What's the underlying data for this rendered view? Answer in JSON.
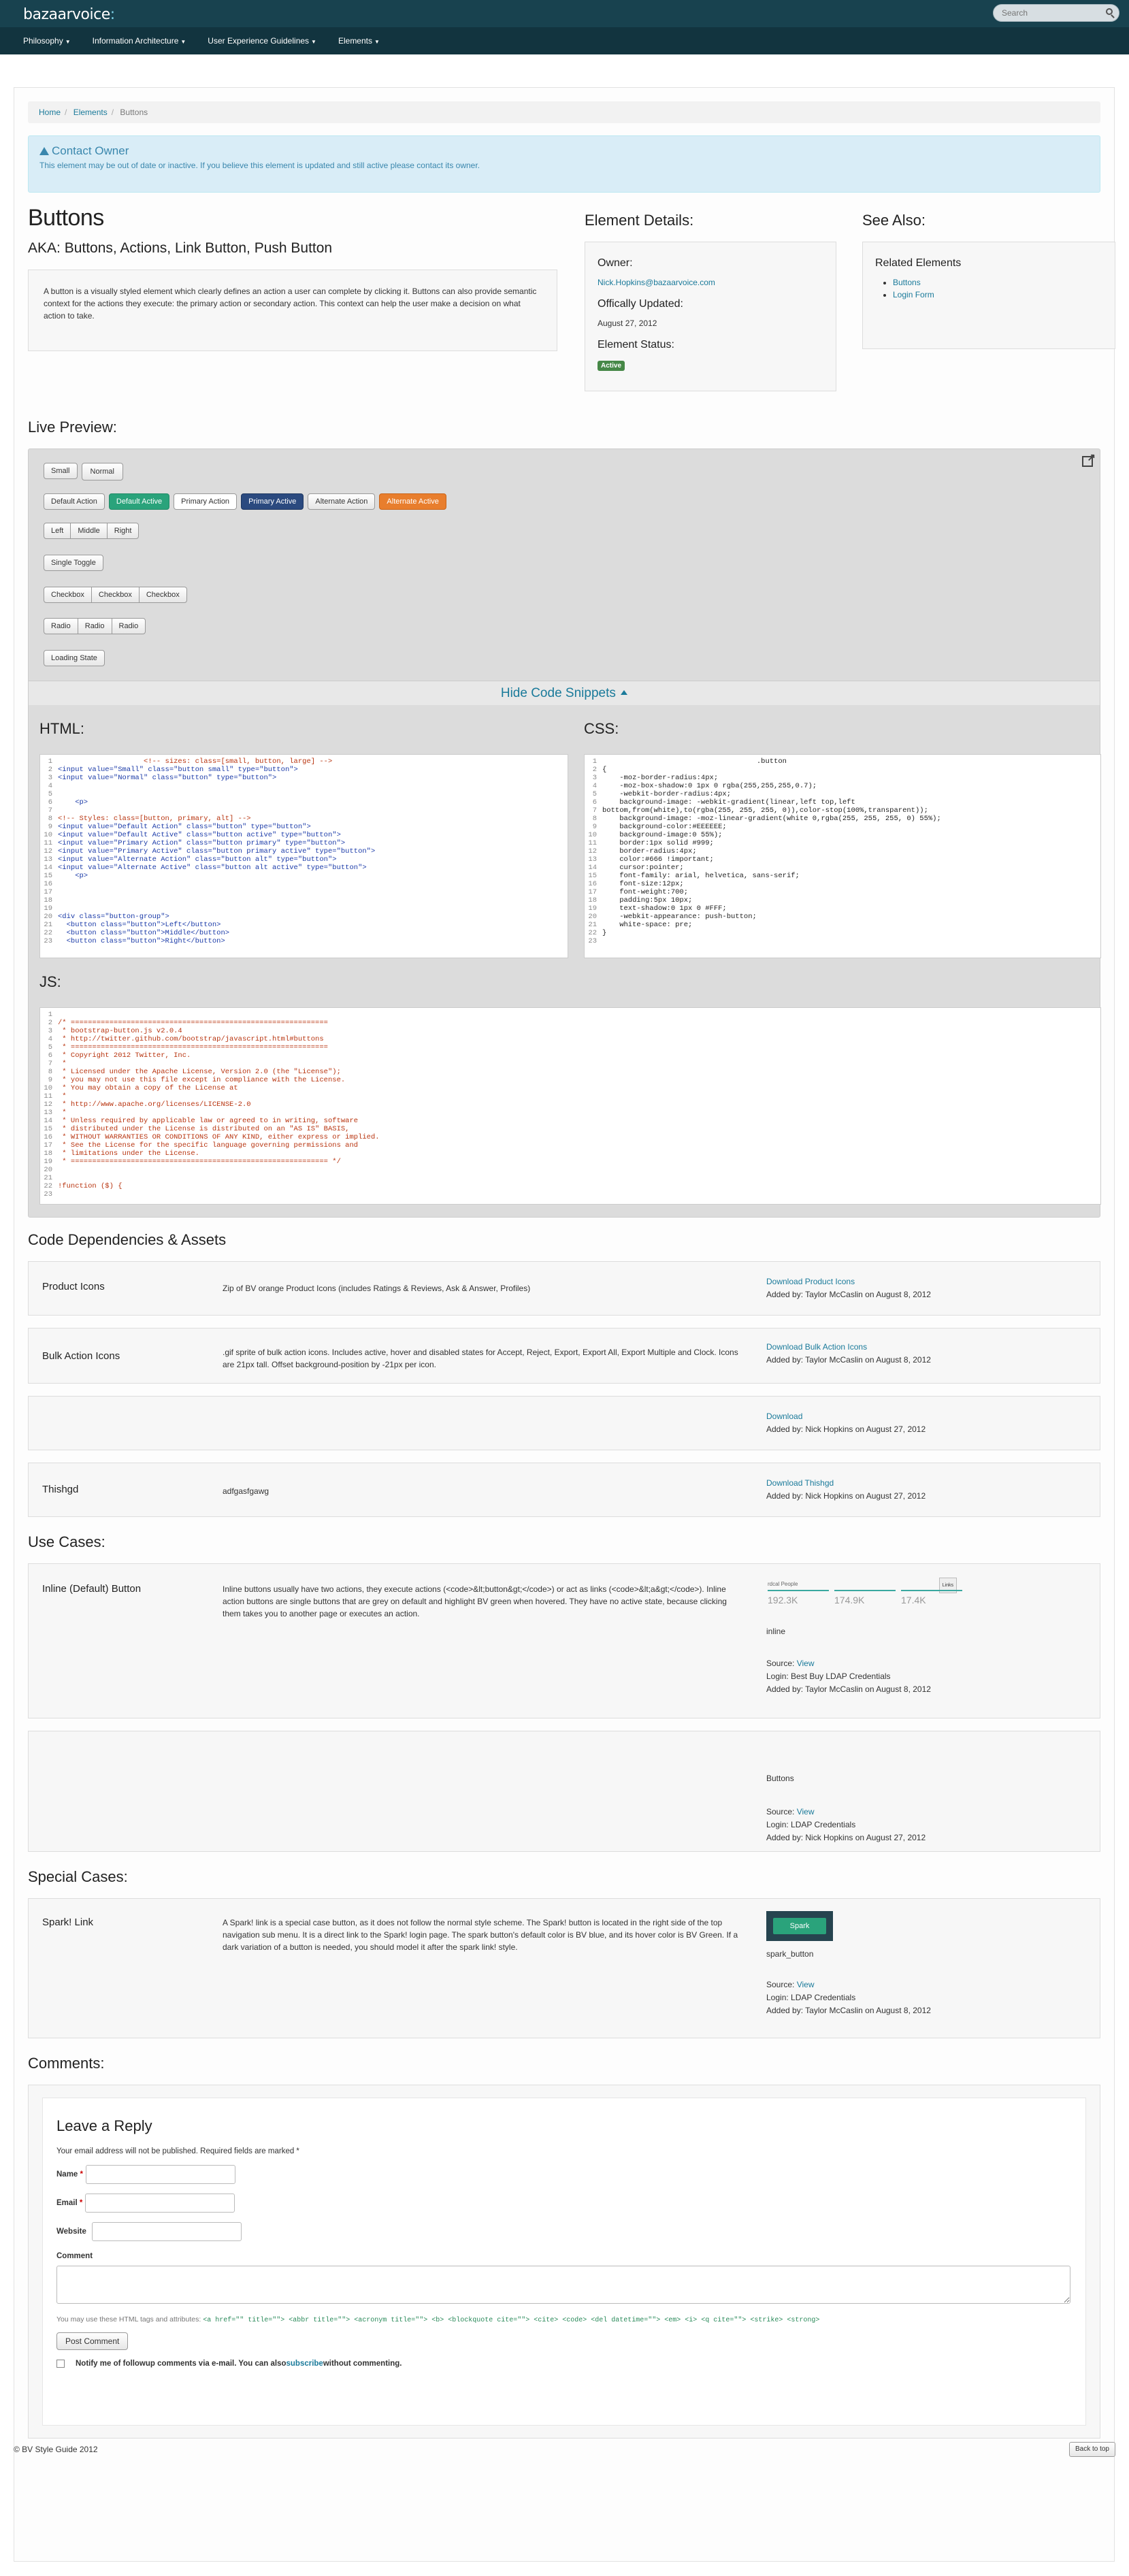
{
  "header": {
    "logo_main": "bazaarvoice",
    "logo_dot": ":",
    "search_placeholder": "Search"
  },
  "nav": [
    "Philosophy",
    "Information Architecture",
    "User Experience Guidelines",
    "Elements"
  ],
  "breadcrumb": {
    "home": "Home",
    "elements": "Elements",
    "current": "Buttons"
  },
  "alert": {
    "title": "Contact Owner",
    "text": "This element may be out of date or inactive. If you believe this element is updated and still active please contact its owner."
  },
  "element": {
    "title": "Buttons",
    "aka": "AKA: Buttons, Actions, Link Button, Push Button",
    "description": "A button is a visually styled element which clearly defines an action a user can complete by clicking it. Buttons can also provide semantic context for the actions they execute: the primary action or secondary action. This context can help the user make a decision on what action to take."
  },
  "details": {
    "heading": "Element Details:",
    "owner_label": "Owner:",
    "owner": "Nick.Hopkins@bazaarvoice.com",
    "updated_label": "Offically Updated:",
    "updated": "August 27, 2012",
    "status_label": "Element Status:",
    "status": "Active"
  },
  "see_also": {
    "heading": "See Also:",
    "sub": "Related Elements",
    "items": [
      "Buttons",
      "Login Form"
    ]
  },
  "preview": {
    "heading": "Live Preview:",
    "size_buttons": [
      "Small",
      "Normal"
    ],
    "style_buttons": [
      "Default Action",
      "Default Active",
      "Primary Action",
      "Primary Active",
      "Alternate Action",
      "Alternate Active"
    ],
    "group_buttons": [
      "Left",
      "Middle",
      "Right"
    ],
    "toggle": "Single Toggle",
    "checkboxes": [
      "Checkbox",
      "Checkbox",
      "Checkbox"
    ],
    "radios": [
      "Radio",
      "Radio",
      "Radio"
    ],
    "loading": "Loading State",
    "hide_code": "Hide Code Snippets",
    "html_label": "HTML:",
    "css_label": "CSS:",
    "js_label": "JS:",
    "html_lines": [
      "                    <!-- sizes: class=[small, button, large] -->",
      "<input value=\"Small\" class=\"button small\" type=\"button\">",
      "<input value=\"Normal\" class=\"button\" type=\"button\">",
      "",
      "",
      "    <p>",
      "",
      "<!-- Styles: class=[button, primary, alt] -->",
      "<input value=\"Default Action\" class=\"button\" type=\"button\">",
      "<input value=\"Default Active\" class=\"button active\" type=\"button\">",
      "<input value=\"Primary Action\" class=\"button primary\" type=\"button\">",
      "<input value=\"Primary Active\" class=\"button primary active\" type=\"button\">",
      "<input value=\"Alternate Action\" class=\"button alt\" type=\"button\">",
      "<input value=\"Alternate Active\" class=\"button alt active\" type=\"button\">",
      "    <p>",
      "",
      "",
      "",
      "",
      "<div class=\"button-group\">",
      "  <button class=\"button\">Left</button>",
      "  <button class=\"button\">Middle</button>",
      "  <button class=\"button\">Right</button>"
    ],
    "css_lines": [
      "                                    .button",
      "{",
      "    -moz-border-radius:4px;",
      "    -moz-box-shadow:0 1px 0 rgba(255,255,255,0.7);",
      "    -webkit-border-radius:4px;",
      "    background-image: -webkit-gradient(linear,left top,left",
      "bottom,from(white),to(rgba(255, 255, 255, 0)),color-stop(100%,transparent));",
      "    background-image: -moz-linear-gradient(white 0,rgba(255, 255, 255, 0) 55%);",
      "    background-color:#EEEEEE;",
      "    background-image:0 55%);",
      "    border:1px solid #999;",
      "    border-radius:4px;",
      "    color:#666 !important;",
      "    cursor:pointer;",
      "    font-family: arial, helvetica, sans-serif;",
      "    font-size:12px;",
      "    font-weight:700;",
      "    padding:5px 10px;",
      "    text-shadow:0 1px 0 #FFF;",
      "    -webkit-appearance: push-button;",
      "    white-space: pre;",
      "}",
      ""
    ],
    "js_lines": [
      "",
      "/* ============================================================",
      " * bootstrap-button.js v2.0.4",
      " * http://twitter.github.com/bootstrap/javascript.html#buttons",
      " * ============================================================",
      " * Copyright 2012 Twitter, Inc.",
      " *",
      " * Licensed under the Apache License, Version 2.0 (the \"License\");",
      " * you may not use this file except in compliance with the License.",
      " * You may obtain a copy of the License at",
      " *",
      " * http://www.apache.org/licenses/LICENSE-2.0",
      " *",
      " * Unless required by applicable law or agreed to in writing, software",
      " * distributed under the License is distributed on an \"AS IS\" BASIS,",
      " * WITHOUT WARRANTIES OR CONDITIONS OF ANY KIND, either express or implied.",
      " * See the License for the specific language governing permissions and",
      " * limitations under the License.",
      " * ============================================================ */",
      "",
      "",
      "!function ($) {",
      ""
    ]
  },
  "deps": {
    "heading": "Code Dependencies & Assets",
    "items": [
      {
        "name": "Product Icons",
        "text": "Zip of BV orange Product Icons (includes Ratings & Reviews, Ask & Answer, Profiles)",
        "link": "Download Product Icons",
        "added": "Added by: Taylor McCaslin on August 8, 2012"
      },
      {
        "name": "Bulk Action Icons",
        "text": ".gif sprite of bulk action icons. Includes active, hover and disabled states for Accept, Reject, Export, Export All, Export Multiple and Clock. Icons are 21px tall. Offset background-position by -21px per icon.",
        "link": "Download Bulk Action Icons",
        "added": "Added by: Taylor McCaslin on August 8, 2012"
      },
      {
        "name": "",
        "text": "",
        "link": "Download",
        "added": "Added by: Nick Hopkins on August 27, 2012"
      },
      {
        "name": "Thishgd",
        "text": "adfgasfgawg",
        "link": "Download Thishgd",
        "added": "Added by: Nick Hopkins on August 27, 2012"
      }
    ]
  },
  "use_cases": {
    "heading": "Use Cases:",
    "items": [
      {
        "name": "Inline (Default) Button",
        "text": "Inline buttons usually have two actions, they execute actions (<code>&lt;button&gt;</code>) or act as links (<code>&lt;a&gt;</code>). Inline action buttons are single buttons that are grey on default and highlight BV green when hovered. They have no active state, because clicking them takes you to another page or executes an action.",
        "thumb_title": "rdcal People",
        "thumb_button": "Links",
        "thumb_stats": [
          "192.3K",
          "174.9K",
          "17.4K"
        ],
        "caption": "inline",
        "source_label": "Source: ",
        "source_link": "View",
        "login": "Login: Best Buy LDAP Credentials",
        "added": "Added by: Taylor McCaslin on August 8, 2012"
      },
      {
        "name": "",
        "text": "",
        "caption": "Buttons",
        "source_label": "Source: ",
        "source_link": "View",
        "login": "Login: LDAP Credentials",
        "added": "Added by: Nick Hopkins on August 27, 2012"
      }
    ]
  },
  "special_cases": {
    "heading": "Special Cases:",
    "name": "Spark! Link",
    "text": "A Spark! link is a special case button, as it does not follow the normal style scheme. The Spark! button is located in the right side of the top navigation sub menu. It is a direct link to the Spark! login page. The spark button's default color is BV blue, and its hover color is BV Green. If a dark variation of a button is needed, you should model it after the spark link! style.",
    "thumb_label": "Spark",
    "caption": "spark_button",
    "source_label": "Source: ",
    "source_link": "View",
    "login": "Login: LDAP Credentials",
    "added": "Added by: Taylor McCaslin on August 8, 2012"
  },
  "comments": {
    "heading": "Comments:",
    "reply_title": "Leave a Reply",
    "note": "Your email address will not be published. Required fields are marked *",
    "name_label": "Name",
    "email_label": "Email",
    "website_label": "Website",
    "comment_label": "Comment",
    "allowed_text": "You may use these HTML tags and attributes:",
    "allowed_tags": "<a href=\"\" title=\"\"> <abbr title=\"\"> <acronym title=\"\"> <b> <blockquote cite=\"\"> <cite> <code> <del datetime=\"\"> <em> <i> <q cite=\"\"> <strike> <strong>",
    "post": "Post Comment",
    "notify_pre": "Notify me of followup comments via e-mail. You can also ",
    "notify_link": "subscribe",
    "notify_post": " without commenting."
  },
  "footer": {
    "copyright": "© BV Style Guide 2012",
    "back_to_top": "Back to top"
  }
}
